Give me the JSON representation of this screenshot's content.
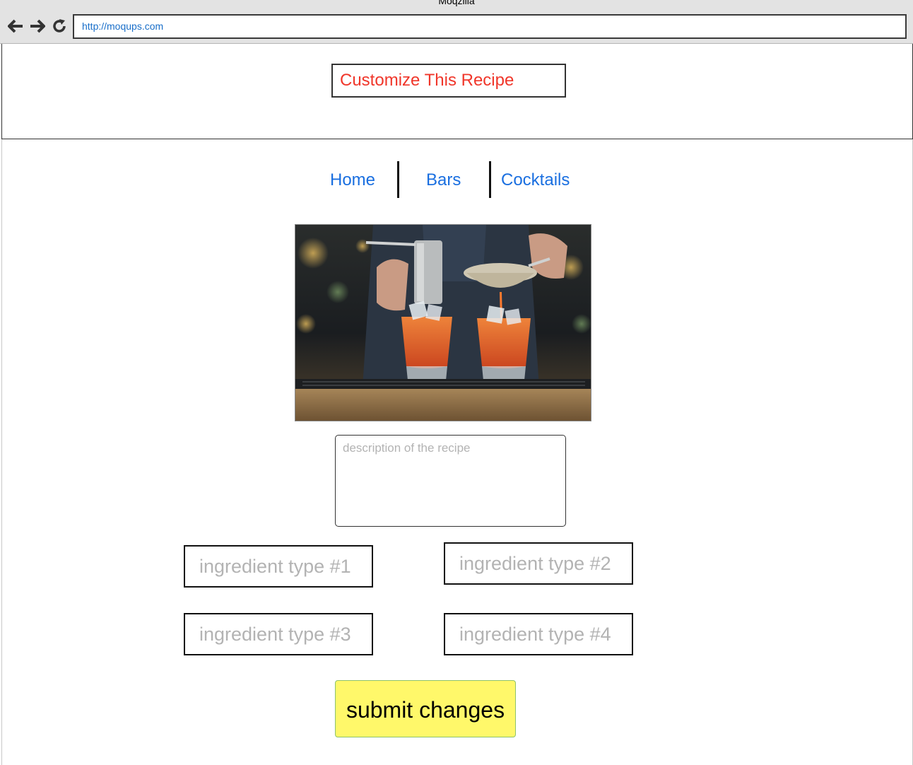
{
  "window": {
    "title": "Moqzilla"
  },
  "browser": {
    "url": "http://moqups.com",
    "back_icon": "arrow-left-icon",
    "forward_icon": "arrow-right-icon",
    "reload_icon": "reload-icon"
  },
  "header": {
    "title": "Customize This Recipe"
  },
  "nav": {
    "items": [
      {
        "label": "Home"
      },
      {
        "label": "Bars"
      },
      {
        "label": "Cocktails"
      }
    ]
  },
  "hero": {
    "image": "photo: bartender straining an orange cocktail into two glasses with ice"
  },
  "form": {
    "description_placeholder": "description of the recipe",
    "ingredients": [
      {
        "placeholder": "ingredient type #1"
      },
      {
        "placeholder": "ingredient type #2"
      },
      {
        "placeholder": "ingredient type #3"
      },
      {
        "placeholder": "ingredient type #4"
      }
    ],
    "submit_label": "submit changes"
  },
  "colors": {
    "title_text": "#f0362a",
    "nav_link": "#1a6fe0",
    "submit_bg": "#fff86a",
    "placeholder": "#b3b3b3"
  }
}
